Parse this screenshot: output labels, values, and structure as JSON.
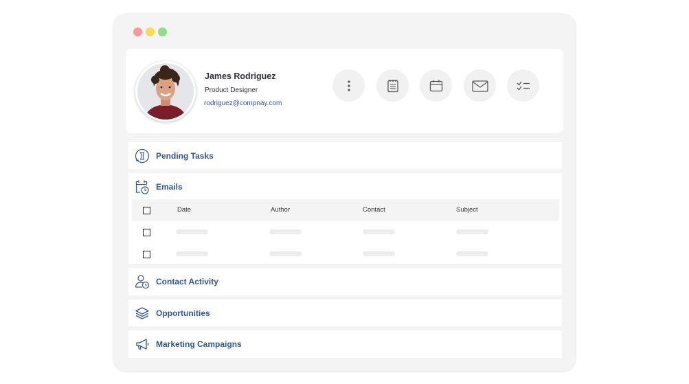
{
  "window": {
    "controls": [
      "red-dot",
      "yellow-dot",
      "green-dot"
    ]
  },
  "profile": {
    "name": "James Rodriguez",
    "role": "Product Designer",
    "email": "rodriguez@compnay.com"
  },
  "actions": [
    {
      "icon": "more-vertical-icon"
    },
    {
      "icon": "notes-icon"
    },
    {
      "icon": "calendar-icon"
    },
    {
      "icon": "mail-icon"
    },
    {
      "icon": "checklist-icon"
    }
  ],
  "sections": {
    "pending_tasks": {
      "title": "Pending Tasks",
      "icon": "hourglass-icon"
    },
    "emails": {
      "title": "Emails",
      "icon": "calendar-clock-icon",
      "columns": [
        "Date",
        "Author",
        "Contact",
        "Subject"
      ],
      "rows": [
        {
          "checked": false
        },
        {
          "checked": false
        }
      ]
    },
    "contact_activity": {
      "title": "Contact Activity",
      "icon": "user-clock-icon"
    },
    "opportunities": {
      "title": "Opportunities",
      "icon": "layers-icon"
    },
    "marketing_campaigns": {
      "title": "Marketing Campaigns",
      "icon": "megaphone-icon"
    }
  },
  "colors": {
    "accent": "#33558f",
    "window_bg": "#f4f4f4",
    "card_bg": "#ffffff"
  }
}
